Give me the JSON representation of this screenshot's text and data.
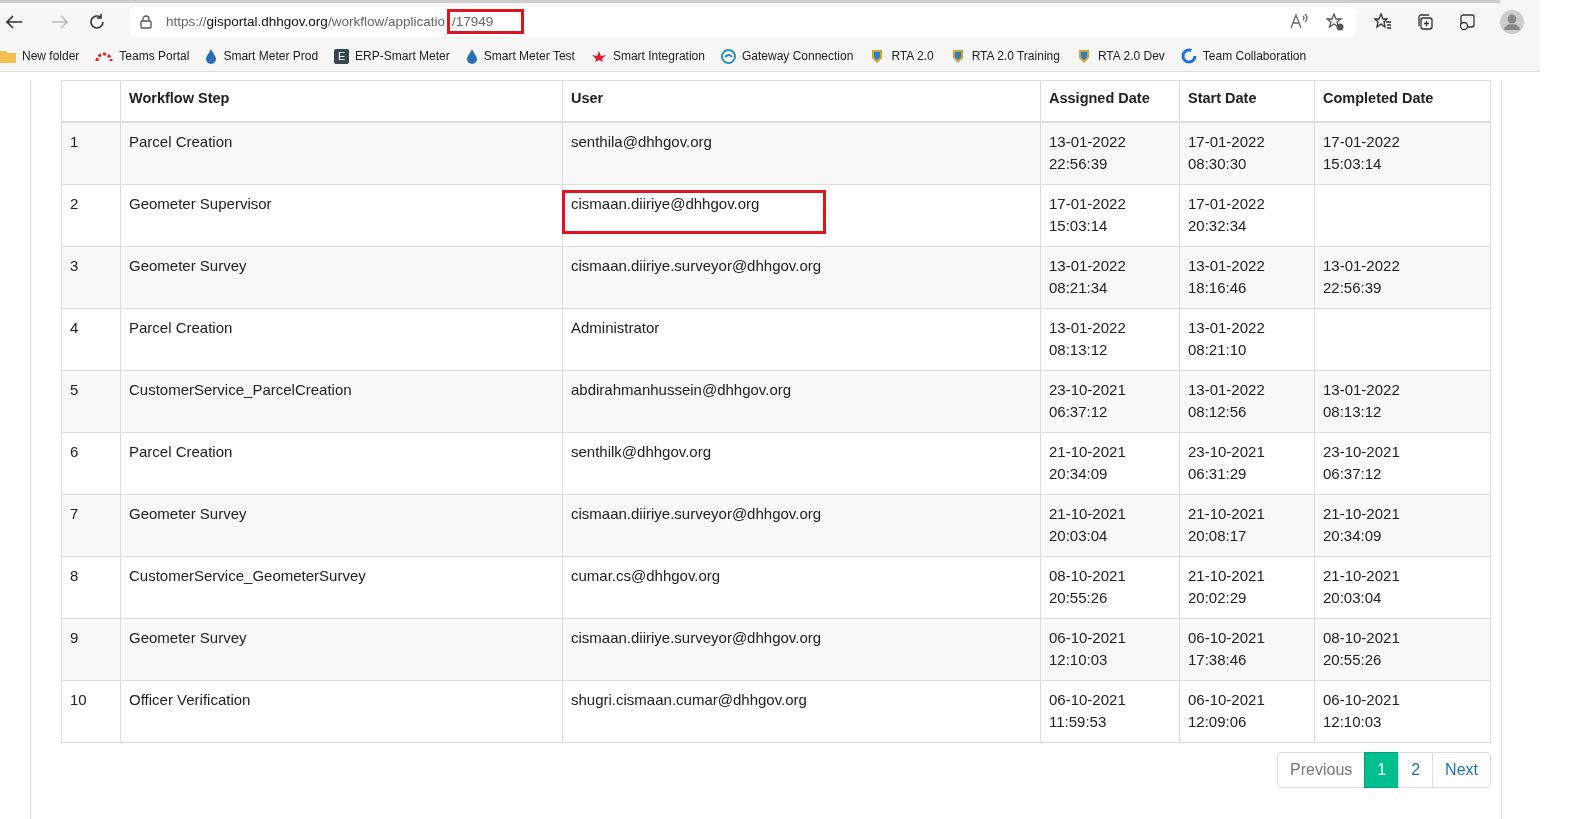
{
  "browser": {
    "url": {
      "scheme": "https://",
      "host": "gisportal.dhhgov.org",
      "path": "/workflow/applicatio",
      "id": "/17949",
      "id_highlighted": true
    },
    "bookmarks": [
      {
        "label": "New folder",
        "kind": "folder"
      },
      {
        "label": "Teams Portal",
        "kind": "arc"
      },
      {
        "label": "Smart Meter Prod",
        "kind": "drop"
      },
      {
        "label": "ERP-Smart Meter",
        "kind": "letter",
        "letter": "E"
      },
      {
        "label": "Smart Meter Test",
        "kind": "drop"
      },
      {
        "label": "Smart Integration",
        "kind": "flower"
      },
      {
        "label": "Gateway Connection",
        "kind": "swirl"
      },
      {
        "label": "RTA 2.0",
        "kind": "crest"
      },
      {
        "label": "RTA 2.0 Training",
        "kind": "crest"
      },
      {
        "label": "RTA 2.0 Dev",
        "kind": "crest"
      },
      {
        "label": "Team Collaboration",
        "kind": "ring"
      }
    ]
  },
  "table": {
    "columns": [
      "Workflow Step",
      "User",
      "Assigned Date",
      "Start Date",
      "Completed Date"
    ],
    "rows": [
      {
        "num": "1",
        "step": "Parcel Creation",
        "user": "senthila@dhhgov.org",
        "user_highlighted": false,
        "assigned": [
          "13-01-2022",
          "22:56:39"
        ],
        "start": [
          "17-01-2022",
          "08:30:30"
        ],
        "completed": [
          "17-01-2022",
          "15:03:14"
        ]
      },
      {
        "num": "2",
        "step": "Geometer Supervisor",
        "user": "cismaan.diiriye@dhhgov.org",
        "user_highlighted": true,
        "assigned": [
          "17-01-2022",
          "15:03:14"
        ],
        "start": [
          "17-01-2022",
          "20:32:34"
        ],
        "completed": []
      },
      {
        "num": "3",
        "step": "Geometer Survey",
        "user": "cismaan.diiriye.surveyor@dhhgov.org",
        "user_highlighted": false,
        "assigned": [
          "13-01-2022",
          "08:21:34"
        ],
        "start": [
          "13-01-2022",
          "18:16:46"
        ],
        "completed": [
          "13-01-2022",
          "22:56:39"
        ]
      },
      {
        "num": "4",
        "step": "Parcel Creation",
        "user": "Administrator",
        "user_highlighted": false,
        "assigned": [
          "13-01-2022",
          "08:13:12"
        ],
        "start": [
          "13-01-2022",
          "08:21:10"
        ],
        "completed": []
      },
      {
        "num": "5",
        "step": "CustomerService_ParcelCreation",
        "user": "abdirahmanhussein@dhhgov.org",
        "user_highlighted": false,
        "assigned": [
          "23-10-2021",
          "06:37:12"
        ],
        "start": [
          "13-01-2022",
          "08:12:56"
        ],
        "completed": [
          "13-01-2022",
          "08:13:12"
        ]
      },
      {
        "num": "6",
        "step": "Parcel Creation",
        "user": "senthilk@dhhgov.org",
        "user_highlighted": false,
        "assigned": [
          "21-10-2021",
          "20:34:09"
        ],
        "start": [
          "23-10-2021",
          "06:31:29"
        ],
        "completed": [
          "23-10-2021",
          "06:37:12"
        ]
      },
      {
        "num": "7",
        "step": "Geometer Survey",
        "user": "cismaan.diiriye.surveyor@dhhgov.org",
        "user_highlighted": false,
        "assigned": [
          "21-10-2021",
          "20:03:04"
        ],
        "start": [
          "21-10-2021",
          "20:08:17"
        ],
        "completed": [
          "21-10-2021",
          "20:34:09"
        ]
      },
      {
        "num": "8",
        "step": "CustomerService_GeometerSurvey",
        "user": "cumar.cs@dhhgov.org",
        "user_highlighted": false,
        "assigned": [
          "08-10-2021",
          "20:55:26"
        ],
        "start": [
          "21-10-2021",
          "20:02:29"
        ],
        "completed": [
          "21-10-2021",
          "20:03:04"
        ]
      },
      {
        "num": "9",
        "step": "Geometer Survey",
        "user": "cismaan.diiriye.surveyor@dhhgov.org",
        "user_highlighted": false,
        "assigned": [
          "06-10-2021",
          "12:10:03"
        ],
        "start": [
          "06-10-2021",
          "17:38:46"
        ],
        "completed": [
          "08-10-2021",
          "20:55:26"
        ]
      },
      {
        "num": "10",
        "step": "Officer Verification",
        "user": "shugri.cismaan.cumar@dhhgov.org",
        "user_highlighted": false,
        "assigned": [
          "06-10-2021",
          "11:59:53"
        ],
        "start": [
          "06-10-2021",
          "12:09:06"
        ],
        "completed": [
          "06-10-2021",
          "12:10:03"
        ]
      }
    ]
  },
  "pagination": {
    "previous": "Previous",
    "pages": [
      {
        "label": "1",
        "selected": true
      },
      {
        "label": "2",
        "selected": false
      }
    ],
    "next": "Next"
  }
}
